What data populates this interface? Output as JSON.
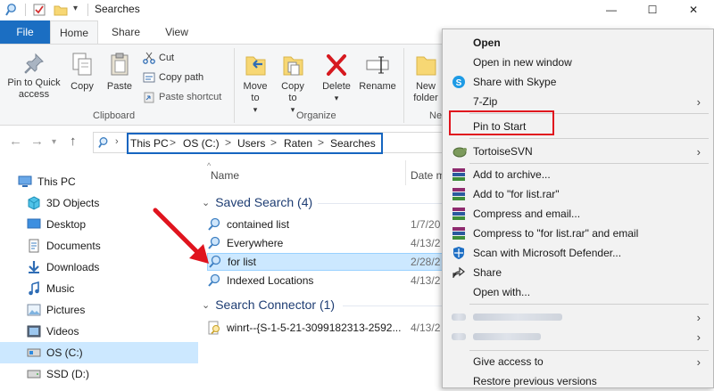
{
  "window": {
    "title": "Searches",
    "controls": {
      "minimize": "—",
      "maximize": "☐",
      "close": "✕"
    }
  },
  "ribbon_tabs": [
    "File",
    "Home",
    "Share",
    "View"
  ],
  "ribbon": {
    "clipboard": {
      "pin_label": "Pin to Quick access",
      "copy_label": "Copy",
      "paste_label": "Paste",
      "cut_label": "Cut",
      "copy_path_label": "Copy path",
      "paste_shortcut_label": "Paste shortcut",
      "group_label": "Clipboard"
    },
    "organize": {
      "move_to_label": "Move to",
      "copy_to_label": "Copy to",
      "delete_label": "Delete",
      "rename_label": "Rename",
      "group_label": "Organize"
    },
    "new": {
      "new_folder_label": "New folder",
      "group_label_partial": "Ne"
    }
  },
  "address": {
    "breadcrumbs": [
      "This PC",
      "OS (C:)",
      "Users",
      "Raten",
      "Searches"
    ],
    "separator": ">"
  },
  "nav_pane": {
    "items": [
      "This PC",
      "3D Objects",
      "Desktop",
      "Documents",
      "Downloads",
      "Music",
      "Pictures",
      "Videos",
      "OS (C:)",
      "SSD (D:)"
    ],
    "selected": "OS (C:)"
  },
  "file_list": {
    "columns": {
      "name": "Name",
      "date": "Date m"
    },
    "groups": [
      {
        "title": "Saved Search (4)",
        "rows": [
          {
            "name": "contained list",
            "date": "1/7/20"
          },
          {
            "name": "Everywhere",
            "date": "4/13/2"
          },
          {
            "name": "for list",
            "date": "2/28/2"
          },
          {
            "name": "Indexed Locations",
            "date": "4/13/2"
          }
        ]
      },
      {
        "title": "Search Connector (1)",
        "rows": [
          {
            "name": "winrt--{S-1-5-21-3099182313-2592...",
            "date": "4/13/2"
          }
        ]
      }
    ]
  },
  "context_menu": {
    "items": [
      {
        "label": "Open",
        "bold": true
      },
      {
        "label": "Open in new window"
      },
      {
        "label": "Share with Skype"
      },
      {
        "label": "7-Zip",
        "submenu": true
      },
      {
        "label": "Pin to Start",
        "highlighted": true
      },
      {
        "label": "TortoiseSVN",
        "submenu": true
      },
      {
        "label": "Add to archive..."
      },
      {
        "label": "Add to \"for list.rar\""
      },
      {
        "label": "Compress and email..."
      },
      {
        "label": "Compress to \"for list.rar\" and email"
      },
      {
        "label": "Scan with Microsoft Defender..."
      },
      {
        "label": "Share"
      },
      {
        "label": "Open with..."
      },
      {
        "label": "Give access to",
        "submenu": true
      },
      {
        "label": "Restore previous versions"
      }
    ],
    "submenu_glyph": "›",
    "highlight_color": "#e0141e"
  },
  "colors": {
    "accent": "#1b6ec2",
    "selection": "#cce8ff",
    "address_highlight": "#1565c0",
    "annotation": "#e0141e"
  }
}
